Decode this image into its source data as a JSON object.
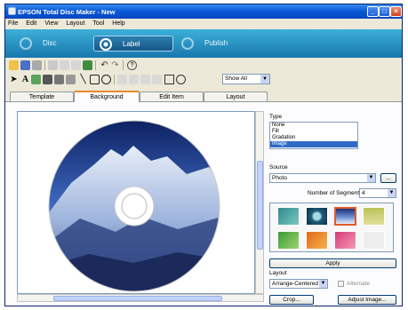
{
  "window": {
    "title": "EPSON Total Disc Maker - New",
    "min_glyph": "_",
    "max_glyph": "□",
    "close_glyph": "×"
  },
  "menu": [
    "File",
    "Edit",
    "View",
    "Layout",
    "Tool",
    "Help"
  ],
  "modes": [
    {
      "label": "Disc",
      "active": false
    },
    {
      "label": "Label",
      "active": true
    },
    {
      "label": "Publish",
      "active": false
    }
  ],
  "toolbar2": {
    "show_all": "Show All"
  },
  "tabs": [
    "Template",
    "Background",
    "Edit Item",
    "Layout"
  ],
  "active_tab": 1,
  "side": {
    "type_label": "Type",
    "type_options": [
      "None",
      "Fill",
      "Gradation",
      "Image"
    ],
    "type_selected": 3,
    "source_label": "Source",
    "source_value": "Photo",
    "browse_label": "...",
    "segments_label": "Number of Segments",
    "segments_value": "4",
    "apply_label": "Apply",
    "layout_label": "Layout",
    "layout_value": "Arrange-Centered",
    "alternate_label": "Alternate",
    "crop_label": "Crop...",
    "adjust_label": "Adjust Image..."
  },
  "icons": [
    "new-icon",
    "open-icon",
    "save-icon",
    "print-icon",
    "undo-icon",
    "redo-icon",
    "help-icon"
  ],
  "colors": {
    "title_bar": "#0a5ad8",
    "mode_bar": "#1e86ba",
    "tab_accent": "#e68b2c",
    "selection": "#316ac5"
  }
}
